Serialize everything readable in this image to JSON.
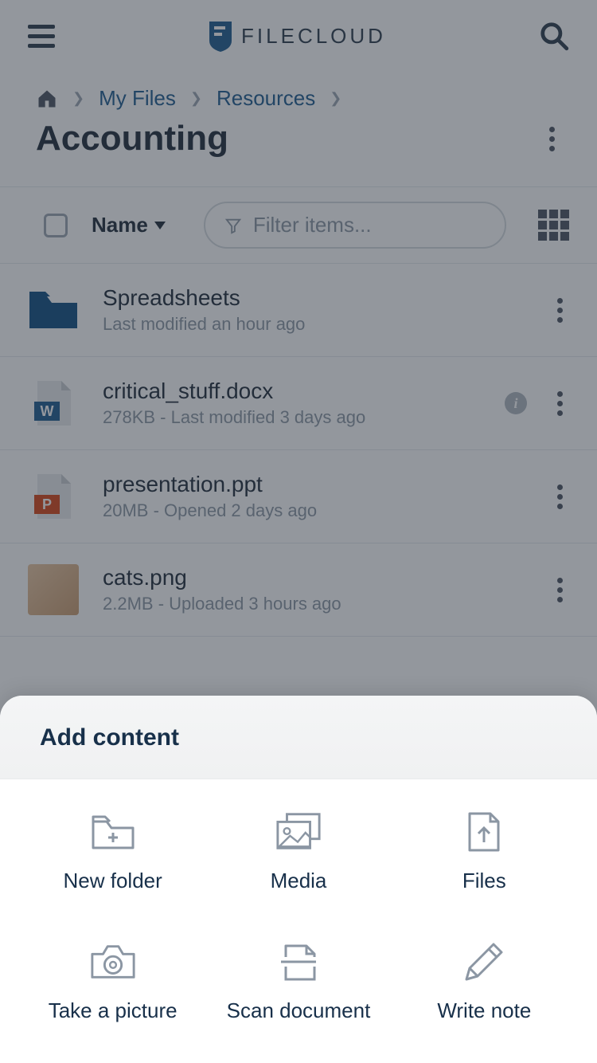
{
  "header": {
    "brand": "FILECLOUD"
  },
  "breadcrumb": {
    "items": [
      "My Files",
      "Resources"
    ]
  },
  "page": {
    "title": "Accounting"
  },
  "controls": {
    "sort_label": "Name",
    "filter_placeholder": "Filter items..."
  },
  "files": [
    {
      "name": "Spreadsheets",
      "meta": "Last modified an hour ago",
      "type": "folder"
    },
    {
      "name": "critical_stuff.docx",
      "meta": "278KB - Last modified 3 days ago",
      "type": "docx",
      "info": true
    },
    {
      "name": "presentation.ppt",
      "meta": "20MB - Opened 2 days ago",
      "type": "ppt"
    },
    {
      "name": "cats.png",
      "meta": "2.2MB - Uploaded 3 hours ago",
      "type": "image"
    }
  ],
  "sheet": {
    "title": "Add content",
    "actions": [
      {
        "label": "New folder"
      },
      {
        "label": "Media"
      },
      {
        "label": "Files"
      },
      {
        "label": "Take a picture"
      },
      {
        "label": "Scan document"
      },
      {
        "label": "Write note"
      }
    ]
  }
}
